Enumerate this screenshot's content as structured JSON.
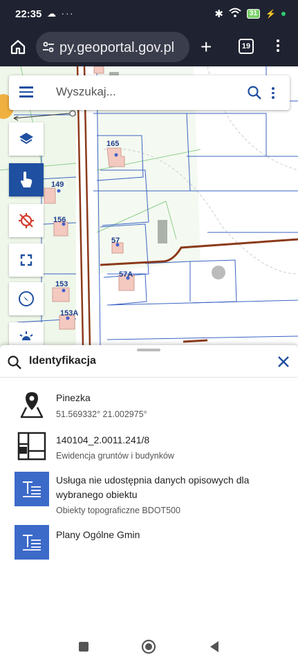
{
  "status": {
    "time": "22:35",
    "left_icons": "☁ ···",
    "battery": "31"
  },
  "browser": {
    "url": "py.geoportal.gov.pl",
    "tab_count": "19"
  },
  "search": {
    "placeholder": "Wyszukaj..."
  },
  "map": {
    "labels": [
      "165",
      "149",
      "156",
      "57",
      "57A",
      "153",
      "153A"
    ]
  },
  "identification": {
    "title": "Identyfikacja",
    "items": [
      {
        "title": "Pinezka",
        "subtitle": "51.569332° 21.002975°",
        "icon": "map-pin-icon"
      },
      {
        "title": "140104_2.0011.241/8",
        "subtitle": "Ewidencja gruntów i budynków",
        "icon": "parcel-icon"
      },
      {
        "title": "Usługa nie udostępnia danych opisowych dla",
        "title2": "wybranego obiektu",
        "subtitle": "Obiekty topograficzne BDOT500",
        "icon": "text-service-icon"
      },
      {
        "title": "Plany Ogólne Gmin",
        "subtitle": "",
        "icon": "text-service-icon"
      }
    ]
  },
  "colors": {
    "accent": "#1e4fa0",
    "road": "#8b3a1a",
    "parcel": "#3b63c4",
    "green": "#7fc37f"
  }
}
